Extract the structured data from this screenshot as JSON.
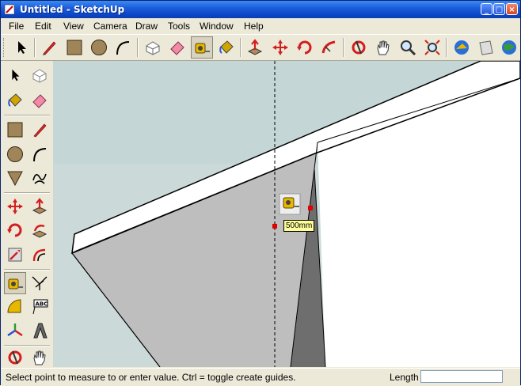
{
  "window": {
    "title": "Untitled - SketchUp",
    "minimize": "_",
    "maximize": "□",
    "close": "×"
  },
  "menu": [
    "File",
    "Edit",
    "View",
    "Camera",
    "Draw",
    "Tools",
    "Window",
    "Help"
  ],
  "toolbar": {
    "tools": [
      "select-icon",
      "pencil-icon",
      "rectangle-icon",
      "circle-icon",
      "arc-icon",
      "make-component-icon",
      "eraser-icon",
      "tape-measure-icon",
      "paint-bucket-icon",
      "push-pull-icon",
      "move-icon",
      "rotate-icon",
      "follow-me-icon",
      "orbit-icon",
      "pan-icon",
      "zoom-icon",
      "zoom-extents-icon",
      "get-models-icon",
      "share-model-icon",
      "google-earth-icon"
    ],
    "pressed": "tape-measure-icon"
  },
  "left_toolbar": {
    "tools": [
      "select-icon",
      "make-component-icon",
      "paint-bucket-icon",
      "eraser-icon",
      "rectangle-icon",
      "line-icon",
      "circle-icon",
      "arc-icon",
      "polygon-icon",
      "freehand-icon",
      "move-icon",
      "push-pull-icon",
      "rotate-icon",
      "follow-me-icon",
      "scale-icon",
      "offset-icon",
      "tape-measure-icon",
      "dimension-icon",
      "protractor-icon",
      "text-icon",
      "axes-icon",
      "3d-text-icon",
      "orbit-icon",
      "pan-icon"
    ],
    "pressed": "tape-measure-icon"
  },
  "viewport": {
    "tooltip": "500mm",
    "sky_color": "#C4D6D6",
    "face_color": "#BEBEBE",
    "dark_face_color": "#6E6E6E"
  },
  "status": {
    "text": "Select point to measure to or enter value.  Ctrl = toggle create guides.",
    "length_label": "Length",
    "length_value": ""
  }
}
